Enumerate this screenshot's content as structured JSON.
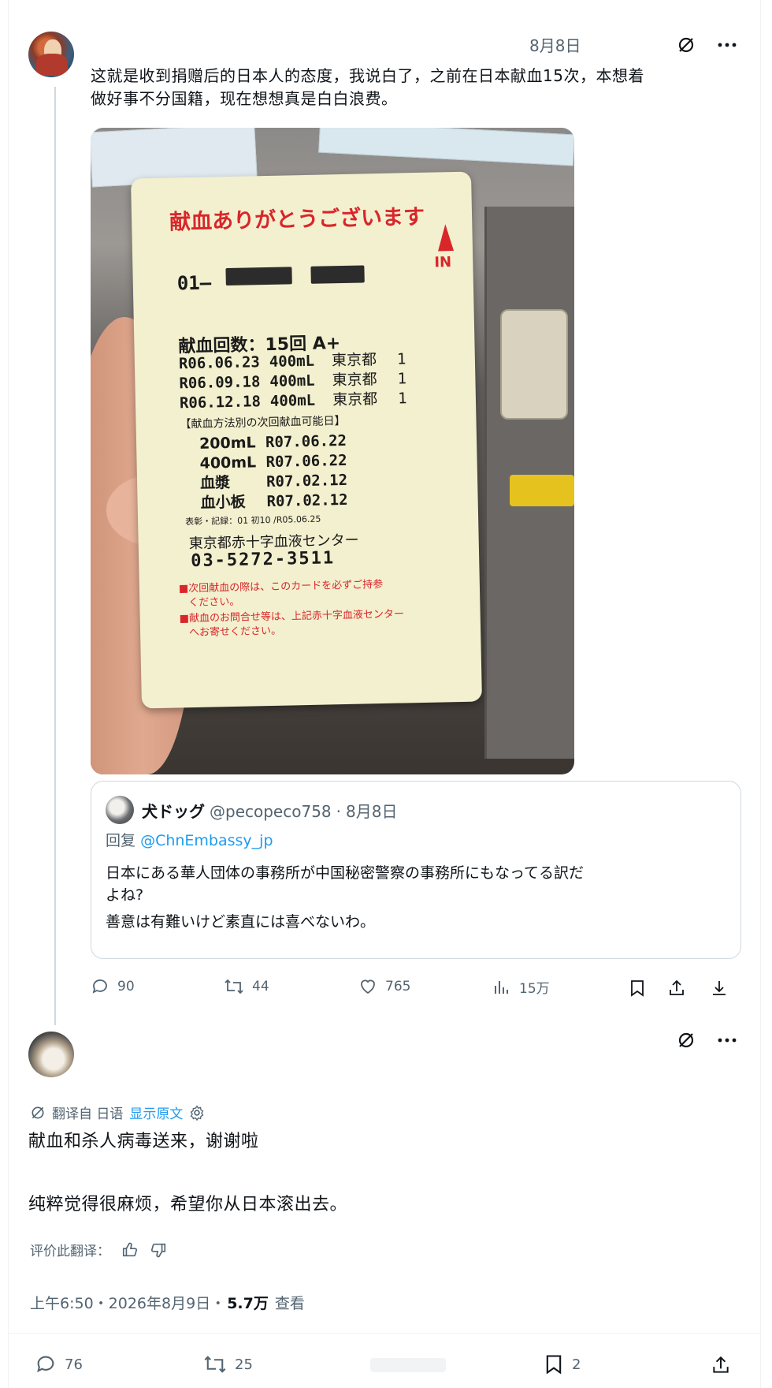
{
  "original_post": {
    "date": "8月8日",
    "text_line1": "这就是收到捐赠后的日本人的态度，我说白了，之前在日本献血15次，本想着",
    "text_line2": "做好事不分国籍，现在想想真是白白浪费。",
    "card": {
      "header": "献血ありがとうございます",
      "direction_label": "IN",
      "id_prefix": "01—",
      "count_line": "献血回数：15回  A+",
      "history": [
        {
          "date": "R06.06.23",
          "amount": "400mL",
          "place": "東京都",
          "num": "1"
        },
        {
          "date": "R06.09.18",
          "amount": "400mL",
          "place": "東京都",
          "num": "1"
        },
        {
          "date": "R06.12.18",
          "amount": "400mL",
          "place": "東京都",
          "num": "1"
        }
      ],
      "next_header": "【献血方法別の次回献血可能日】",
      "next_dates": [
        {
          "type": "200mL",
          "date": "R07.06.22"
        },
        {
          "type": "400mL",
          "date": "R07.06.22"
        },
        {
          "type": "血漿",
          "date": "R07.02.12"
        },
        {
          "type": "血小板",
          "date": "R07.02.12"
        }
      ],
      "issue_line": "表彰・記録：01 初10  /R05.06.25",
      "center_name": "東京都赤十字血液センター",
      "phone": "03-5272-3511",
      "notice1_a": "■次回献血の際は、このカードを必ずご持参",
      "notice1_b": "ください。",
      "notice2_a": "■献血のお問合せ等は、上記赤十字血液センター",
      "notice2_b": "へお寄せください。"
    },
    "quote": {
      "name": "犬ドッグ",
      "handle": "@pecopeco758",
      "date": "8月8日",
      "reply_prefix": "回复",
      "reply_to": "@ChnEmbassy_jp",
      "text_line1": "日本にある華人団体の事務所が中国秘密警察の事務所にもなってる訳だ",
      "text_line2": "よね?",
      "text_line3": "善意は有難いけど素直には喜べないわ。"
    },
    "actions": {
      "replies": "90",
      "reposts": "44",
      "likes": "765",
      "views": "15万"
    }
  },
  "reply_post": {
    "translation_label": "翻译自 日语",
    "show_original": "显示原文",
    "text_line1": "献血和杀人病毒送来，谢谢啦",
    "text_line2": "纯粹觉得很麻烦，希望你从日本滚出去。",
    "rate_label": "评价此翻译：",
    "timestamp": "上午6:50・2026年8月9日・",
    "views_count": "5.7万",
    "views_label": "查看",
    "actions": {
      "replies": "76",
      "reposts": "25",
      "bookmarks": "2"
    }
  },
  "colors": {
    "accent": "#1d9bf0",
    "muted": "#536471",
    "card_red": "#d8262b"
  }
}
